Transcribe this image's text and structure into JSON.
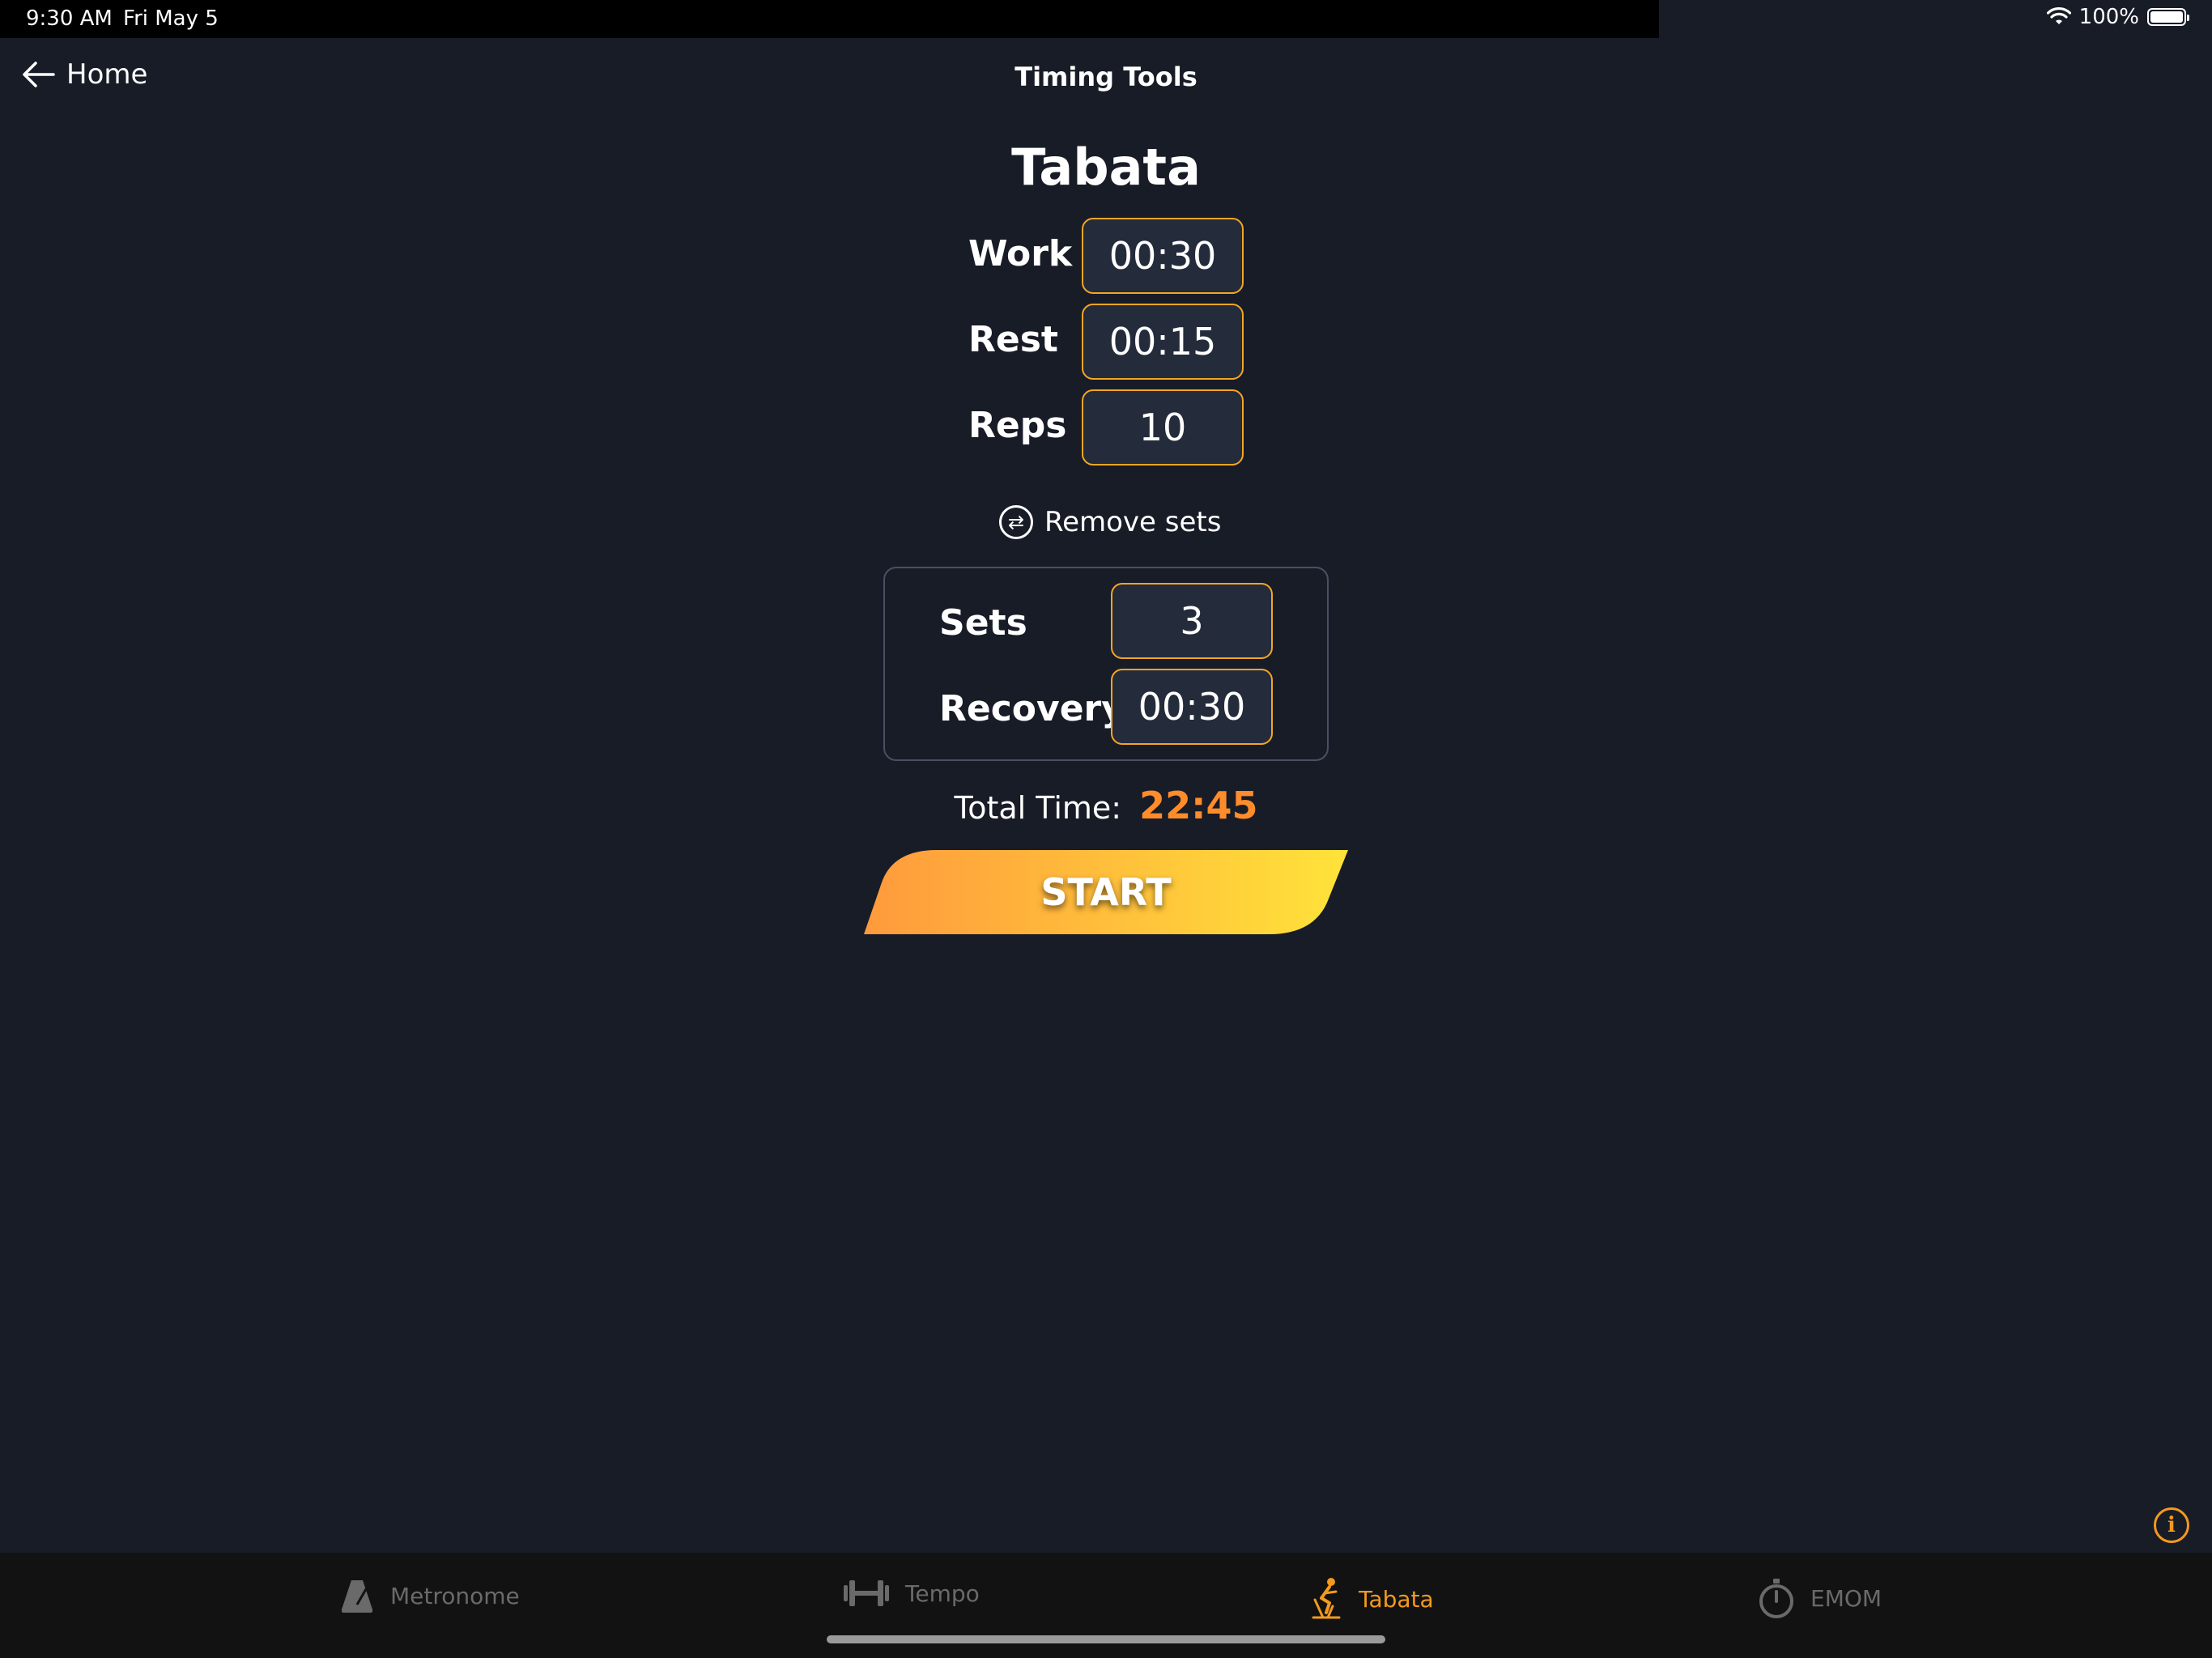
{
  "status_bar": {
    "time": "9:30 AM",
    "date": "Fri May 5",
    "battery": "100%"
  },
  "nav": {
    "back_label": "Home",
    "title": "Timing Tools"
  },
  "page": {
    "title": "Tabata"
  },
  "fields": {
    "work": {
      "label": "Work",
      "value": "00:30"
    },
    "rest": {
      "label": "Rest",
      "value": "00:15"
    },
    "reps": {
      "label": "Reps",
      "value": "10"
    }
  },
  "remove_sets_label": "Remove sets",
  "sets_panel": {
    "sets": {
      "label": "Sets",
      "value": "3"
    },
    "recovery": {
      "label": "Recovery",
      "value": "00:30"
    }
  },
  "total": {
    "label": "Total Time:",
    "value": "22:45"
  },
  "start_label": "START",
  "tabs": [
    {
      "label": "Metronome",
      "icon": "metronome-icon",
      "active": false
    },
    {
      "label": "Tempo",
      "icon": "dumbbell-icon",
      "active": false
    },
    {
      "label": "Tabata",
      "icon": "exercise-bike-icon",
      "active": true
    },
    {
      "label": "EMOM",
      "icon": "stopwatch-icon",
      "active": false
    }
  ],
  "colors": {
    "background": "#181c27",
    "accent": "#f39a1e",
    "total_value": "#ff8c2a",
    "field_border": "#f5a623",
    "field_bg": "#242b3b",
    "start_gradient_start": "#ff9a3c",
    "start_gradient_end": "#ffe33a"
  }
}
